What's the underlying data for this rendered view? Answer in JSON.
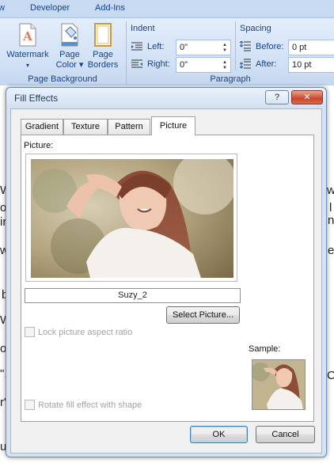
{
  "ribbon": {
    "tabs": [
      "w",
      "Developer",
      "Add-Ins"
    ],
    "page_background": {
      "label": "Page Background",
      "buttons": [
        {
          "line1": "Watermark",
          "line2": "▾"
        },
        {
          "line1": "Page",
          "line2": "Color ▾"
        },
        {
          "line1": "Page",
          "line2": "Borders"
        }
      ]
    },
    "paragraph": {
      "label": "Paragraph",
      "indent_title": "Indent",
      "left_label": "Left:",
      "left_value": "0\"",
      "right_label": "Right:",
      "right_value": "0\"",
      "spacing_title": "Spacing",
      "before_label": "Before:",
      "before_value": "0 pt",
      "after_label": "After:",
      "after_value": "10 pt"
    }
  },
  "document_fragments": [
    "W",
    "o",
    "ir",
    "w",
    "b",
    "W",
    "ou",
    "\",",
    "r\"",
    "ur",
    "w",
    "l",
    "n",
    "e",
    "Co"
  ],
  "dialog": {
    "title": "Fill Effects",
    "help_label": "?",
    "close_label": "✕",
    "tabs": [
      "Gradient",
      "Texture",
      "Pattern",
      "Picture"
    ],
    "active_tab": "Picture",
    "picture_label": "Picture:",
    "picture_name": "Suzy_2",
    "select_picture_label": "Select Picture...",
    "lock_aspect_label": "Lock picture aspect ratio",
    "rotate_fill_label": "Rotate fill effect with shape",
    "sample_label": "Sample:",
    "ok_label": "OK",
    "cancel_label": "Cancel"
  },
  "colors": {
    "ribbon_text": "#15428b",
    "dialog_frame": "#d5e2f2",
    "close_button": "#c9462c",
    "default_button_border": "#3c7fb1"
  }
}
